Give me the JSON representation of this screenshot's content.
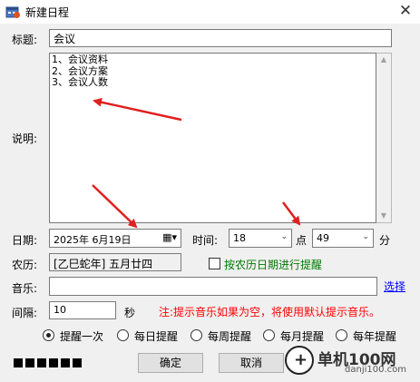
{
  "window": {
    "title": "新建日程",
    "close_glyph": "✕"
  },
  "form": {
    "title_label": "标题:",
    "title_value": "会议",
    "desc_label": "说明:",
    "desc_lines": [
      "1、会议资料",
      "2、会议方案",
      "3、会议人数"
    ],
    "date_label": "日期:",
    "date_value": "2025年  6月19日",
    "time_label": "时间:",
    "hour_value": "18",
    "hour_suffix": "点",
    "minute_value": "49",
    "minute_suffix": "分",
    "lunar_label": "农历:",
    "lunar_value": "[乙巳蛇年] 五月廿四",
    "lunar_checkbox_label": "按农历日期进行提醒",
    "music_label": "音乐:",
    "music_value": "",
    "select_link": "选择",
    "interval_label": "间隔:",
    "interval_value": "10",
    "interval_unit": "秒",
    "note": "注:提示音乐如果为空，将使用默认提示音乐。"
  },
  "reminder_options": [
    {
      "label": "提醒一次",
      "selected": true
    },
    {
      "label": "每日提醒",
      "selected": false
    },
    {
      "label": "每周提醒",
      "selected": false
    },
    {
      "label": "每月提醒",
      "selected": false
    },
    {
      "label": "每年提醒",
      "selected": false
    }
  ],
  "buttons": {
    "ok": "确定",
    "cancel": "取消"
  },
  "watermark": {
    "brand": "单机100网",
    "domain": "danji100.com"
  },
  "colors": {
    "note": "#ff0000",
    "link": "#0000ff",
    "lunar_checkbox": "#007a00",
    "annotation_arrow": "#e02020"
  }
}
